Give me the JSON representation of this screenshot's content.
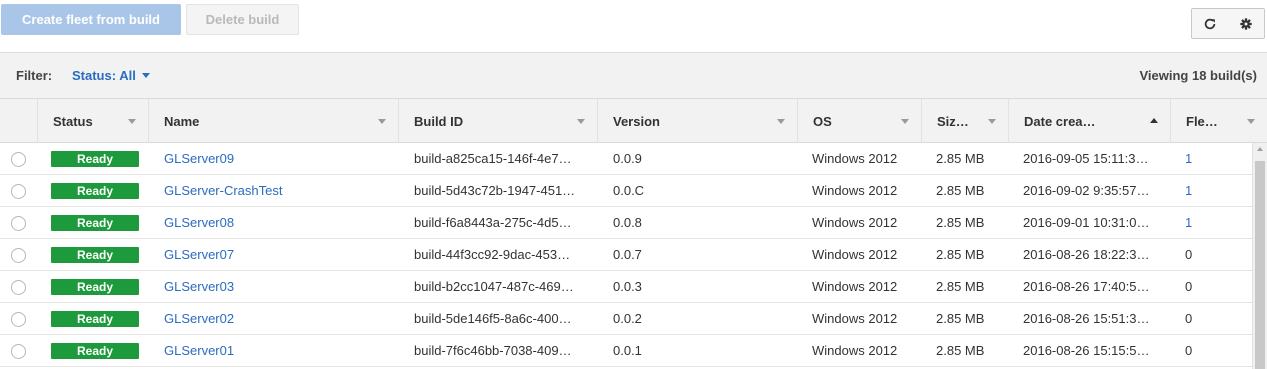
{
  "toolbar": {
    "create_label": "Create fleet from build",
    "delete_label": "Delete build",
    "refresh_icon": "refresh-icon",
    "settings_icon": "gear-icon"
  },
  "filter": {
    "label": "Filter:",
    "value": "Status: All",
    "viewing": "Viewing 18 build(s)"
  },
  "columns": [
    {
      "label": "Status"
    },
    {
      "label": "Name"
    },
    {
      "label": "Build ID"
    },
    {
      "label": "Version"
    },
    {
      "label": "OS"
    },
    {
      "label": "Siz…"
    },
    {
      "label": "Date crea…"
    },
    {
      "label": "Fle…"
    }
  ],
  "rows": [
    {
      "status": "Ready",
      "name": "GLServer09",
      "build_id": "build-a825ca15-146f-4e7…",
      "version": "0.0.9",
      "os": "Windows 2012",
      "size": "2.85 MB",
      "date": "2016-09-05 15:11:3…",
      "fleets": "1"
    },
    {
      "status": "Ready",
      "name": "GLServer-CrashTest",
      "build_id": "build-5d43c72b-1947-451…",
      "version": "0.0.C",
      "os": "Windows 2012",
      "size": "2.85 MB",
      "date": "2016-09-02 9:35:57…",
      "fleets": "1"
    },
    {
      "status": "Ready",
      "name": "GLServer08",
      "build_id": "build-f6a8443a-275c-4d5…",
      "version": "0.0.8",
      "os": "Windows 2012",
      "size": "2.85 MB",
      "date": "2016-09-01 10:31:0…",
      "fleets": "1"
    },
    {
      "status": "Ready",
      "name": "GLServer07",
      "build_id": "build-44f3cc92-9dac-453…",
      "version": "0.0.7",
      "os": "Windows 2012",
      "size": "2.85 MB",
      "date": "2016-08-26 18:22:3…",
      "fleets": "0"
    },
    {
      "status": "Ready",
      "name": "GLServer03",
      "build_id": "build-b2cc1047-487c-469…",
      "version": "0.0.3",
      "os": "Windows 2012",
      "size": "2.85 MB",
      "date": "2016-08-26 17:40:5…",
      "fleets": "0"
    },
    {
      "status": "Ready",
      "name": "GLServer02",
      "build_id": "build-5de146f5-8a6c-400…",
      "version": "0.0.2",
      "os": "Windows 2012",
      "size": "2.85 MB",
      "date": "2016-08-26 15:51:3…",
      "fleets": "0"
    },
    {
      "status": "Ready",
      "name": "GLServer01",
      "build_id": "build-7f6c46bb-7038-409…",
      "version": "0.0.1",
      "os": "Windows 2012",
      "size": "2.85 MB",
      "date": "2016-08-26 15:15:5…",
      "fleets": "0"
    }
  ],
  "colors": {
    "ready_badge": "#1d9a3b",
    "link": "#2a6cbf",
    "primary_disabled": "#a9c6e8"
  }
}
